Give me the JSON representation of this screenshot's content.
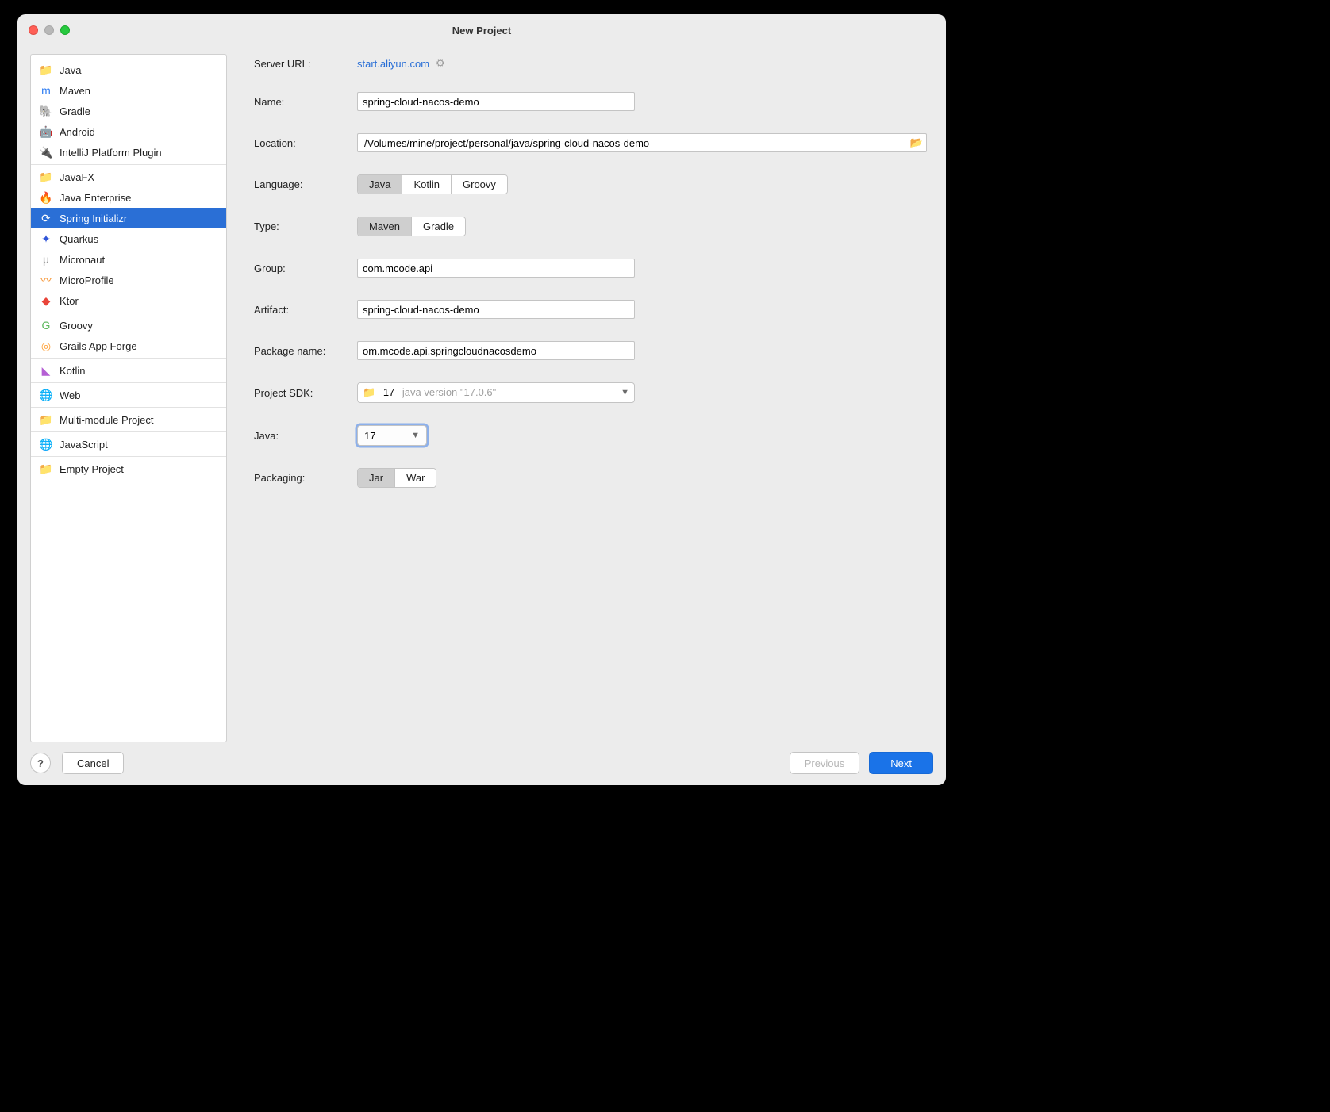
{
  "window": {
    "title": "New Project"
  },
  "sidebar": {
    "groups": [
      {
        "items": [
          {
            "label": "Java",
            "icon": "📁",
            "color": "#6e91c5"
          },
          {
            "label": "Maven",
            "icon": "m",
            "color": "#2f7df2"
          },
          {
            "label": "Gradle",
            "icon": "🐘",
            "color": "#8a8a8a"
          },
          {
            "label": "Android",
            "icon": "🤖",
            "color": "#3ddc84"
          },
          {
            "label": "IntelliJ Platform Plugin",
            "icon": "🔌",
            "color": "#7a7a7a"
          }
        ]
      },
      {
        "items": [
          {
            "label": "JavaFX",
            "icon": "📁",
            "color": "#6e91c5"
          },
          {
            "label": "Java Enterprise",
            "icon": "🔥",
            "color": "#f58a1f"
          },
          {
            "label": "Spring Initializr",
            "icon": "⟳",
            "color": "#6db33f",
            "selected": true
          },
          {
            "label": "Quarkus",
            "icon": "✦",
            "color": "#3055d8"
          },
          {
            "label": "Micronaut",
            "icon": "μ",
            "color": "#7a7a7a"
          },
          {
            "label": "MicroProfile",
            "icon": "〰",
            "color": "#f58a1f"
          },
          {
            "label": "Ktor",
            "icon": "◆",
            "color": "#e9453a"
          }
        ]
      },
      {
        "items": [
          {
            "label": "Groovy",
            "icon": "G",
            "color": "#5cb85c"
          },
          {
            "label": "Grails App Forge",
            "icon": "◎",
            "color": "#ff9d2f"
          }
        ]
      },
      {
        "items": [
          {
            "label": "Kotlin",
            "icon": "◣",
            "color": "#b55fd4"
          }
        ]
      },
      {
        "items": [
          {
            "label": "Web",
            "icon": "🌐",
            "color": "#9c9c9c"
          }
        ]
      },
      {
        "items": [
          {
            "label": "Multi-module Project",
            "icon": "📁",
            "color": "#6e91c5"
          }
        ]
      },
      {
        "items": [
          {
            "label": "JavaScript",
            "icon": "🌐",
            "color": "#9c9c9c"
          }
        ]
      },
      {
        "items": [
          {
            "label": "Empty Project",
            "icon": "📁",
            "color": "#6e91c5"
          }
        ]
      }
    ]
  },
  "form": {
    "server_url_label": "Server URL:",
    "server_url": "start.aliyun.com",
    "name_label": "Name:",
    "name": "spring-cloud-nacos-demo",
    "location_label": "Location:",
    "location": "/Volumes/mine/project/personal/java/spring-cloud-nacos-demo",
    "language_label": "Language:",
    "languages": [
      "Java",
      "Kotlin",
      "Groovy"
    ],
    "language_selected": "Java",
    "type_label": "Type:",
    "types": [
      "Maven",
      "Gradle"
    ],
    "type_selected": "Maven",
    "group_label": "Group:",
    "group": "com.mcode.api",
    "artifact_label": "Artifact:",
    "artifact": "spring-cloud-nacos-demo",
    "package_label": "Package name:",
    "package": "om.mcode.api.springcloudnacosdemo",
    "sdk_label": "Project SDK:",
    "sdk_name": "17",
    "sdk_version": "java version \"17.0.6\"",
    "java_label": "Java:",
    "java_version": "17",
    "packaging_label": "Packaging:",
    "packagings": [
      "Jar",
      "War"
    ],
    "packaging_selected": "Jar"
  },
  "footer": {
    "cancel": "Cancel",
    "previous": "Previous",
    "next": "Next"
  }
}
